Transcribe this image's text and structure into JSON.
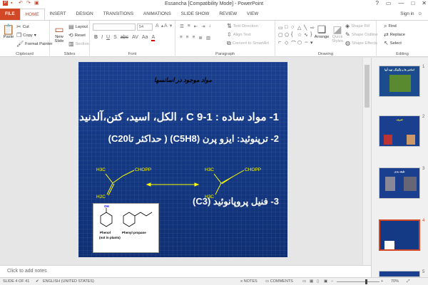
{
  "window": {
    "title": "Essancha [Compatibility Mode] - PowerPoint",
    "controls": [
      "?",
      "▭",
      "—",
      "□",
      "✕"
    ]
  },
  "tabs": [
    "FILE",
    "HOME",
    "INSERT",
    "DESIGN",
    "TRANSITIONS",
    "ANIMATIONS",
    "SLIDE SHOW",
    "REVIEW",
    "VIEW"
  ],
  "active_tab": "HOME",
  "sign_in": "Sign in",
  "ribbon": {
    "clipboard": {
      "label": "Clipboard",
      "paste": "Paste",
      "cut": "Cut",
      "copy": "Copy",
      "format_painter": "Format Painter"
    },
    "slides": {
      "label": "Slides",
      "new_slide": "New Slide",
      "layout": "Layout",
      "reset": "Reset",
      "section": "Section"
    },
    "font": {
      "label": "Font",
      "size": "54"
    },
    "paragraph": {
      "label": "Paragraph",
      "text_direction": "Text Direction",
      "align_text": "Align Text",
      "convert": "Convert to SmartArt"
    },
    "drawing": {
      "label": "Drawing",
      "arrange": "Arrange",
      "quick_styles": "Quick Styles",
      "shape_fill": "Shape Fill",
      "shape_outline": "Shape Outline",
      "shape_effects": "Shape Effects"
    },
    "editing": {
      "label": "Editing",
      "find": "Find",
      "replace": "Replace",
      "select": "Select"
    }
  },
  "slide": {
    "title": "مواد موجود در اسانسها",
    "line1": "1- مواد ساده : C 9-1 ، الکل، اسید، کتن،آلدنید...",
    "line2": "2- ترپنوئید: ایزو پرن (C5H8) ( حداکثر تاC20)",
    "line3": "3- فنیل پروپانوئید (C3)",
    "chem": {
      "left_h3c_top": "H3C",
      "left_h2c": "H2C",
      "left_chopp": "CHOPP",
      "right_h3c_top": "H3C",
      "right_chopp": "CHOPP",
      "right_h3c_bottom": "H3C",
      "phenol": "Phenol",
      "phenol_note": "(not in plants)",
      "phenyl_propane": "Phenyl propane",
      "oh": "OH"
    }
  },
  "notes_placeholder": "Click to add notes",
  "thumbnails": [
    {
      "num": "1",
      "title": "اسانس ها و چگونگی تهیه آنها"
    },
    {
      "num": "2",
      "title": "تعریف"
    },
    {
      "num": "3",
      "title": "طبقه بندی"
    },
    {
      "num": "4",
      "title": ""
    },
    {
      "num": "5",
      "title": ""
    }
  ],
  "status": {
    "slide_info": "SLIDE 4 OF 41",
    "language": "ENGLISH (UNITED STATES)",
    "notes": "NOTES",
    "comments": "COMMENTS",
    "zoom": "70%"
  },
  "colors": {
    "accent": "#d24726",
    "slide_bg": "#143a86",
    "chem_text": "#ffff00"
  }
}
